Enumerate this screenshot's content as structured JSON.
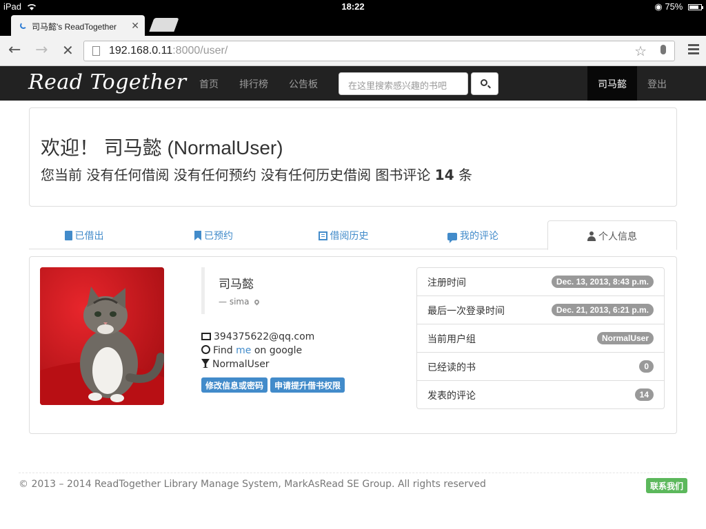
{
  "status_bar": {
    "device": "iPad",
    "time": "18:22",
    "battery": "75%"
  },
  "browser": {
    "tab_title": "司马懿's ReadTogether",
    "url_host": "192.168.0.11",
    "url_rest": ":8000/user/"
  },
  "navbar": {
    "brand": "Read Together",
    "links": [
      "首页",
      "排行榜",
      "公告板"
    ],
    "search_placeholder": "在这里搜索感兴趣的书吧",
    "user": "司马懿",
    "logout": "登出"
  },
  "welcome": {
    "heading": "欢迎！ 司马懿 (NormalUser)",
    "line_prefix": "您当前 没有任何借阅 没有任何预约 没有任何历史借阅 图书评论",
    "comment_count": "14",
    "line_suffix": "条"
  },
  "tabs": [
    {
      "label": "已借出",
      "icon": "book-icon"
    },
    {
      "label": "已预约",
      "icon": "bookmark-icon"
    },
    {
      "label": "借阅历史",
      "icon": "list-icon"
    },
    {
      "label": "我的评论",
      "icon": "comment-icon"
    },
    {
      "label": "个人信息",
      "icon": "user-icon",
      "active": true
    }
  ],
  "profile": {
    "name": "司马懿",
    "nick_dash": "—",
    "nick": "sima",
    "email": "394375622@qq.com",
    "find_prefix": "Find",
    "find_link": "me",
    "find_suffix": "on google",
    "group": "NormalUser",
    "edit_button": "修改信息或密码",
    "upgrade_button": "申请提升借书权限"
  },
  "info_list": [
    {
      "label": "注册时间",
      "value": "Dec. 13, 2013, 8:43 p.m."
    },
    {
      "label": "最后一次登录时间",
      "value": "Dec. 21, 2013, 6:21 p.m."
    },
    {
      "label": "当前用户组",
      "value": "NormalUser"
    },
    {
      "label": "已经读的书",
      "value": "0"
    },
    {
      "label": "发表的评论",
      "value": "14"
    }
  ],
  "footer": {
    "copyright": "© 2013 – 2014 ReadTogether Library Manage System, MarkAsRead SE Group. All rights reserved",
    "contact": "联系我们"
  },
  "colors": {
    "link": "#428bca",
    "navbar": "#222222",
    "success": "#5cb85c",
    "badge": "#999999"
  }
}
